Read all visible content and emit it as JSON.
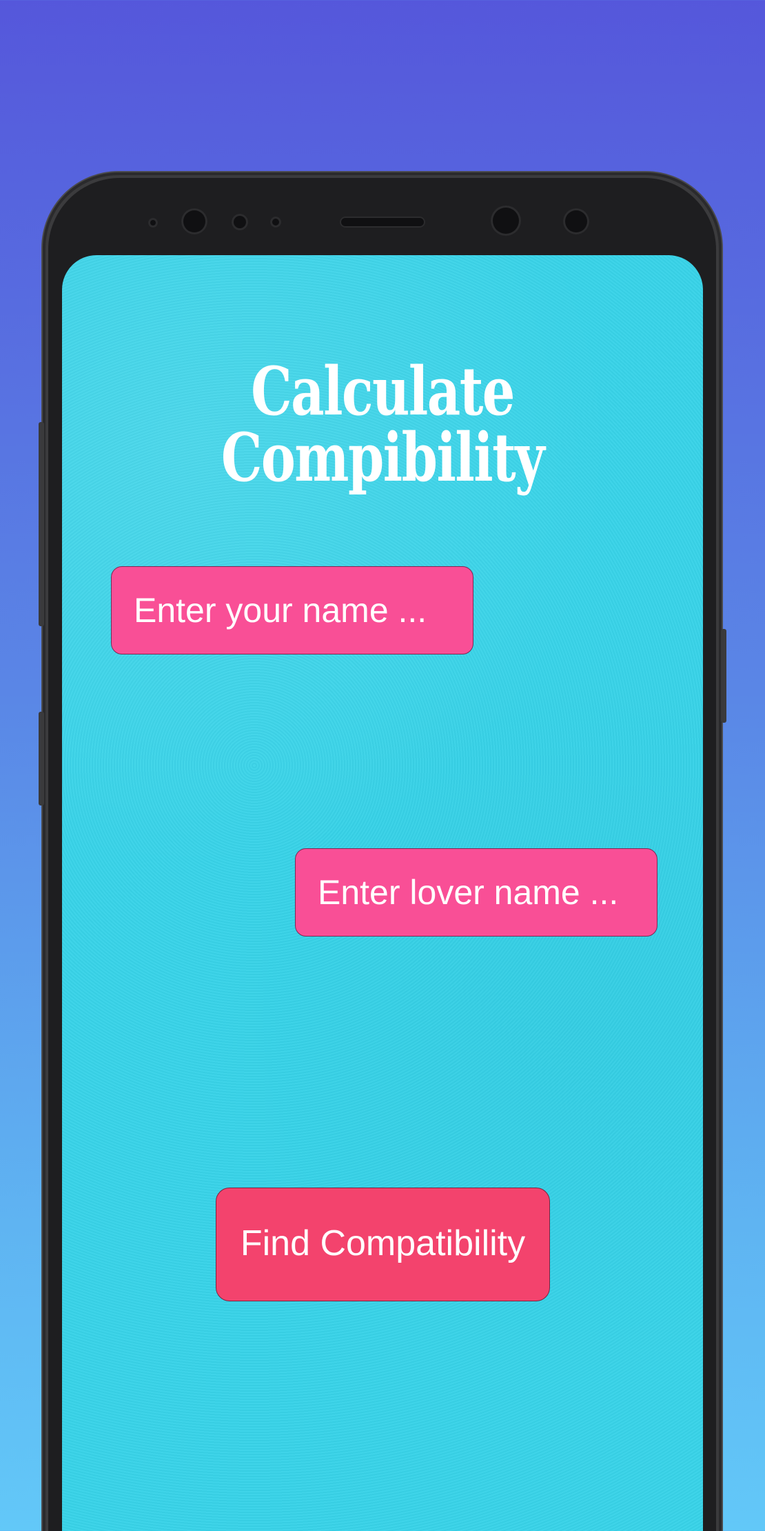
{
  "app": {
    "title": "Calculate Compibility"
  },
  "inputs": {
    "your_name": {
      "value": "",
      "placeholder": "Enter your name ..."
    },
    "lover_name": {
      "value": "",
      "placeholder": "Enter lover name ..."
    }
  },
  "actions": {
    "find_label": "Find Compatibility"
  },
  "colors": {
    "background_top": "#5557db",
    "background_bottom": "#62c8f8",
    "screen": "#38d3e8",
    "input_fill": "#f94f96",
    "button_fill": "#f3436d",
    "text": "#ffffff"
  }
}
